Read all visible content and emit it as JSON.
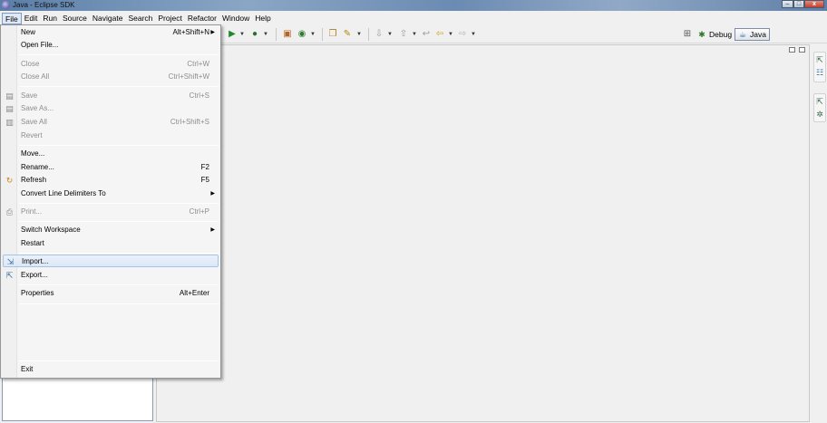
{
  "window": {
    "title": "Java - Eclipse SDK",
    "controls": {
      "minimize": "–",
      "maximize": "□",
      "close": "x"
    }
  },
  "menubar": {
    "items": [
      {
        "label": "File"
      },
      {
        "label": "Edit"
      },
      {
        "label": "Run"
      },
      {
        "label": "Source"
      },
      {
        "label": "Navigate"
      },
      {
        "label": "Search"
      },
      {
        "label": "Project"
      },
      {
        "label": "Refactor"
      },
      {
        "label": "Window"
      },
      {
        "label": "Help"
      }
    ],
    "active": "File"
  },
  "toolbar": {
    "icons": [
      "run-icon",
      "debug-run-icon",
      "external-tools-icon",
      "new-java-package-icon",
      "new-java-class-icon",
      "open-type-icon",
      "search-icon",
      "next-annotation-icon",
      "previous-annotation-icon",
      "last-edit-location-icon",
      "back-icon",
      "forward-icon"
    ],
    "perspectives": [
      {
        "label": "Debug",
        "icon": "debug-perspective-icon"
      },
      {
        "label": "Java",
        "icon": "java-perspective-icon",
        "active": true
      }
    ]
  },
  "file_menu": {
    "items": [
      {
        "label": "New",
        "accel": "Alt+Shift+N",
        "submenu": true,
        "enabled": true
      },
      {
        "label": "Open File...",
        "accel": "",
        "enabled": true
      },
      {
        "label": "Close",
        "accel": "Ctrl+W",
        "enabled": false
      },
      {
        "label": "Close All",
        "accel": "Ctrl+Shift+W",
        "enabled": false
      },
      {
        "label": "Save",
        "accel": "Ctrl+S",
        "enabled": false,
        "icon": "save-icon"
      },
      {
        "label": "Save As...",
        "accel": "",
        "enabled": false,
        "icon": "save-as-icon"
      },
      {
        "label": "Save All",
        "accel": "Ctrl+Shift+S",
        "enabled": false,
        "icon": "save-all-icon"
      },
      {
        "label": "Revert",
        "accel": "",
        "enabled": false
      },
      {
        "label": "Move...",
        "accel": "",
        "enabled": true
      },
      {
        "label": "Rename...",
        "accel": "F2",
        "enabled": true
      },
      {
        "label": "Refresh",
        "accel": "F5",
        "enabled": true,
        "icon": "refresh-icon"
      },
      {
        "label": "Convert Line Delimiters To",
        "accel": "",
        "submenu": true,
        "enabled": true
      },
      {
        "label": "Print...",
        "accel": "Ctrl+P",
        "enabled": false,
        "icon": "print-icon"
      },
      {
        "label": "Switch Workspace",
        "accel": "",
        "submenu": true,
        "enabled": true
      },
      {
        "label": "Restart",
        "accel": "",
        "enabled": true
      },
      {
        "label": "Import...",
        "accel": "",
        "enabled": true,
        "icon": "import-icon",
        "highlighted": true
      },
      {
        "label": "Export...",
        "accel": "",
        "enabled": true,
        "icon": "export-icon"
      },
      {
        "label": "Properties",
        "accel": "Alt+Enter",
        "enabled": true
      },
      {
        "label": "Exit",
        "accel": "",
        "enabled": true
      }
    ]
  },
  "colors": {
    "menu_bg": "#f5f5f5",
    "highlight_border": "#a8c2e6",
    "disabled_text": "#8d8d8d"
  }
}
